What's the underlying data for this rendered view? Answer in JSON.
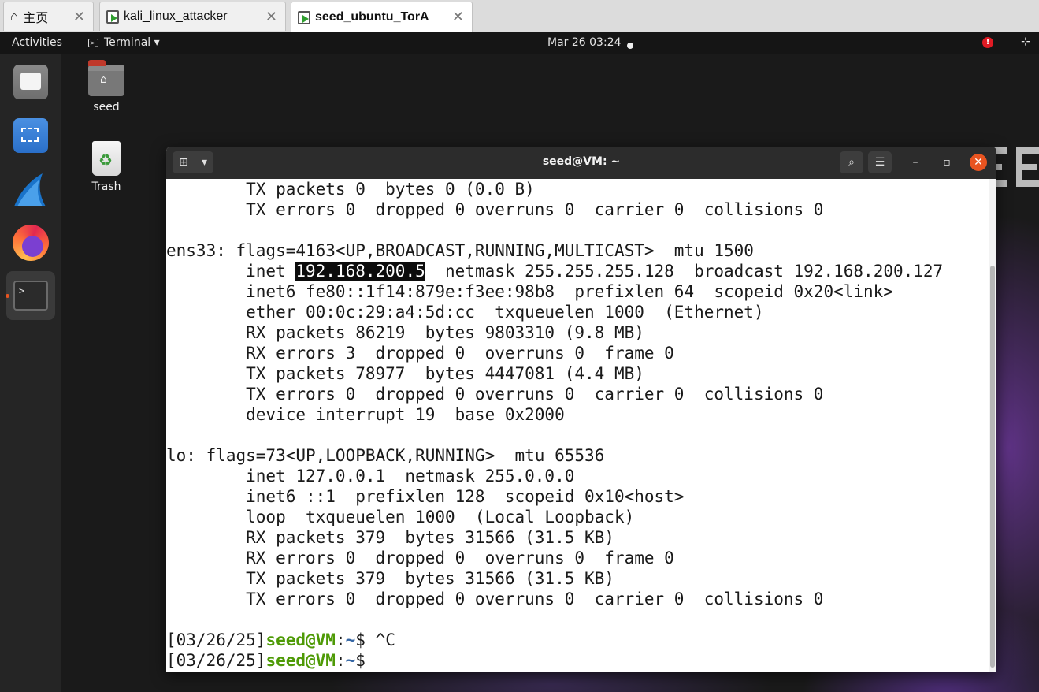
{
  "host_tabs": [
    {
      "label": "主页",
      "icon": "home-icon",
      "active": false
    },
    {
      "label": "kali_linux_attacker",
      "icon": "vm-icon",
      "active": false
    },
    {
      "label": "seed_ubuntu_TorA",
      "icon": "vm-icon",
      "active": true
    }
  ],
  "host_tab_close": "✕",
  "top_bar": {
    "activities": "Activities",
    "app_menu": "Terminal ▾",
    "clock": "Mar 26  03:24",
    "alert": "!"
  },
  "desktop_icons": {
    "home_label": "seed",
    "trash_label": "Trash"
  },
  "terminal": {
    "title": "seed@VM: ~",
    "new_tab_glyph": "⊞",
    "menu_caret": "▾",
    "search_glyph": "⌕",
    "hamburger_glyph": "☰",
    "minimize_glyph": "–",
    "maximize_glyph": "▫",
    "close_glyph": "✕",
    "lines": [
      "        TX packets 0  bytes 0 (0.0 B)",
      "        TX errors 0  dropped 0 overruns 0  carrier 0  collisions 0",
      "",
      "ens33: flags=4163<UP,BROADCAST,RUNNING,MULTICAST>  mtu 1500",
      "",
      "        inet6 fe80::1f14:879e:f3ee:98b8  prefixlen 64  scopeid 0x20<link>",
      "        ether 00:0c:29:a4:5d:cc  txqueuelen 1000  (Ethernet)",
      "        RX packets 86219  bytes 9803310 (9.8 MB)",
      "        RX errors 3  dropped 0  overruns 0  frame 0",
      "        TX packets 78977  bytes 4447081 (4.4 MB)",
      "        TX errors 0  dropped 0 overruns 0  carrier 0  collisions 0",
      "        device interrupt 19  base 0x2000",
      "",
      "lo: flags=73<UP,LOOPBACK,RUNNING>  mtu 65536",
      "        inet 127.0.0.1  netmask 255.0.0.0",
      "        inet6 ::1  prefixlen 128  scopeid 0x10<host>",
      "        loop  txqueuelen 1000  (Local Loopback)",
      "        RX packets 379  bytes 31566 (31.5 KB)",
      "        RX errors 0  dropped 0  overruns 0  frame 0",
      "        TX packets 379  bytes 31566 (31.5 KB)",
      "        TX errors 0  dropped 0 overruns 0  carrier 0  collisions 0",
      ""
    ],
    "inet_line": {
      "prefix": "        inet ",
      "selected": "192.168.200.5",
      "suffix": "  netmask 255.255.255.128  broadcast 192.168.200.127"
    },
    "prompts": [
      {
        "date": "[03/26/25]",
        "user": "seed@VM",
        "colon": ":",
        "path": "~",
        "sign": "$ ",
        "cmd": "^C"
      },
      {
        "date": "[03/26/25]",
        "user": "seed@VM",
        "colon": ":",
        "path": "~",
        "sign": "$ ",
        "cmd": ""
      }
    ]
  },
  "colors": {
    "prompt_user": "#4e9a06",
    "prompt_path": "#3465a4",
    "close_button": "#e95420",
    "alert": "#e01b24"
  }
}
